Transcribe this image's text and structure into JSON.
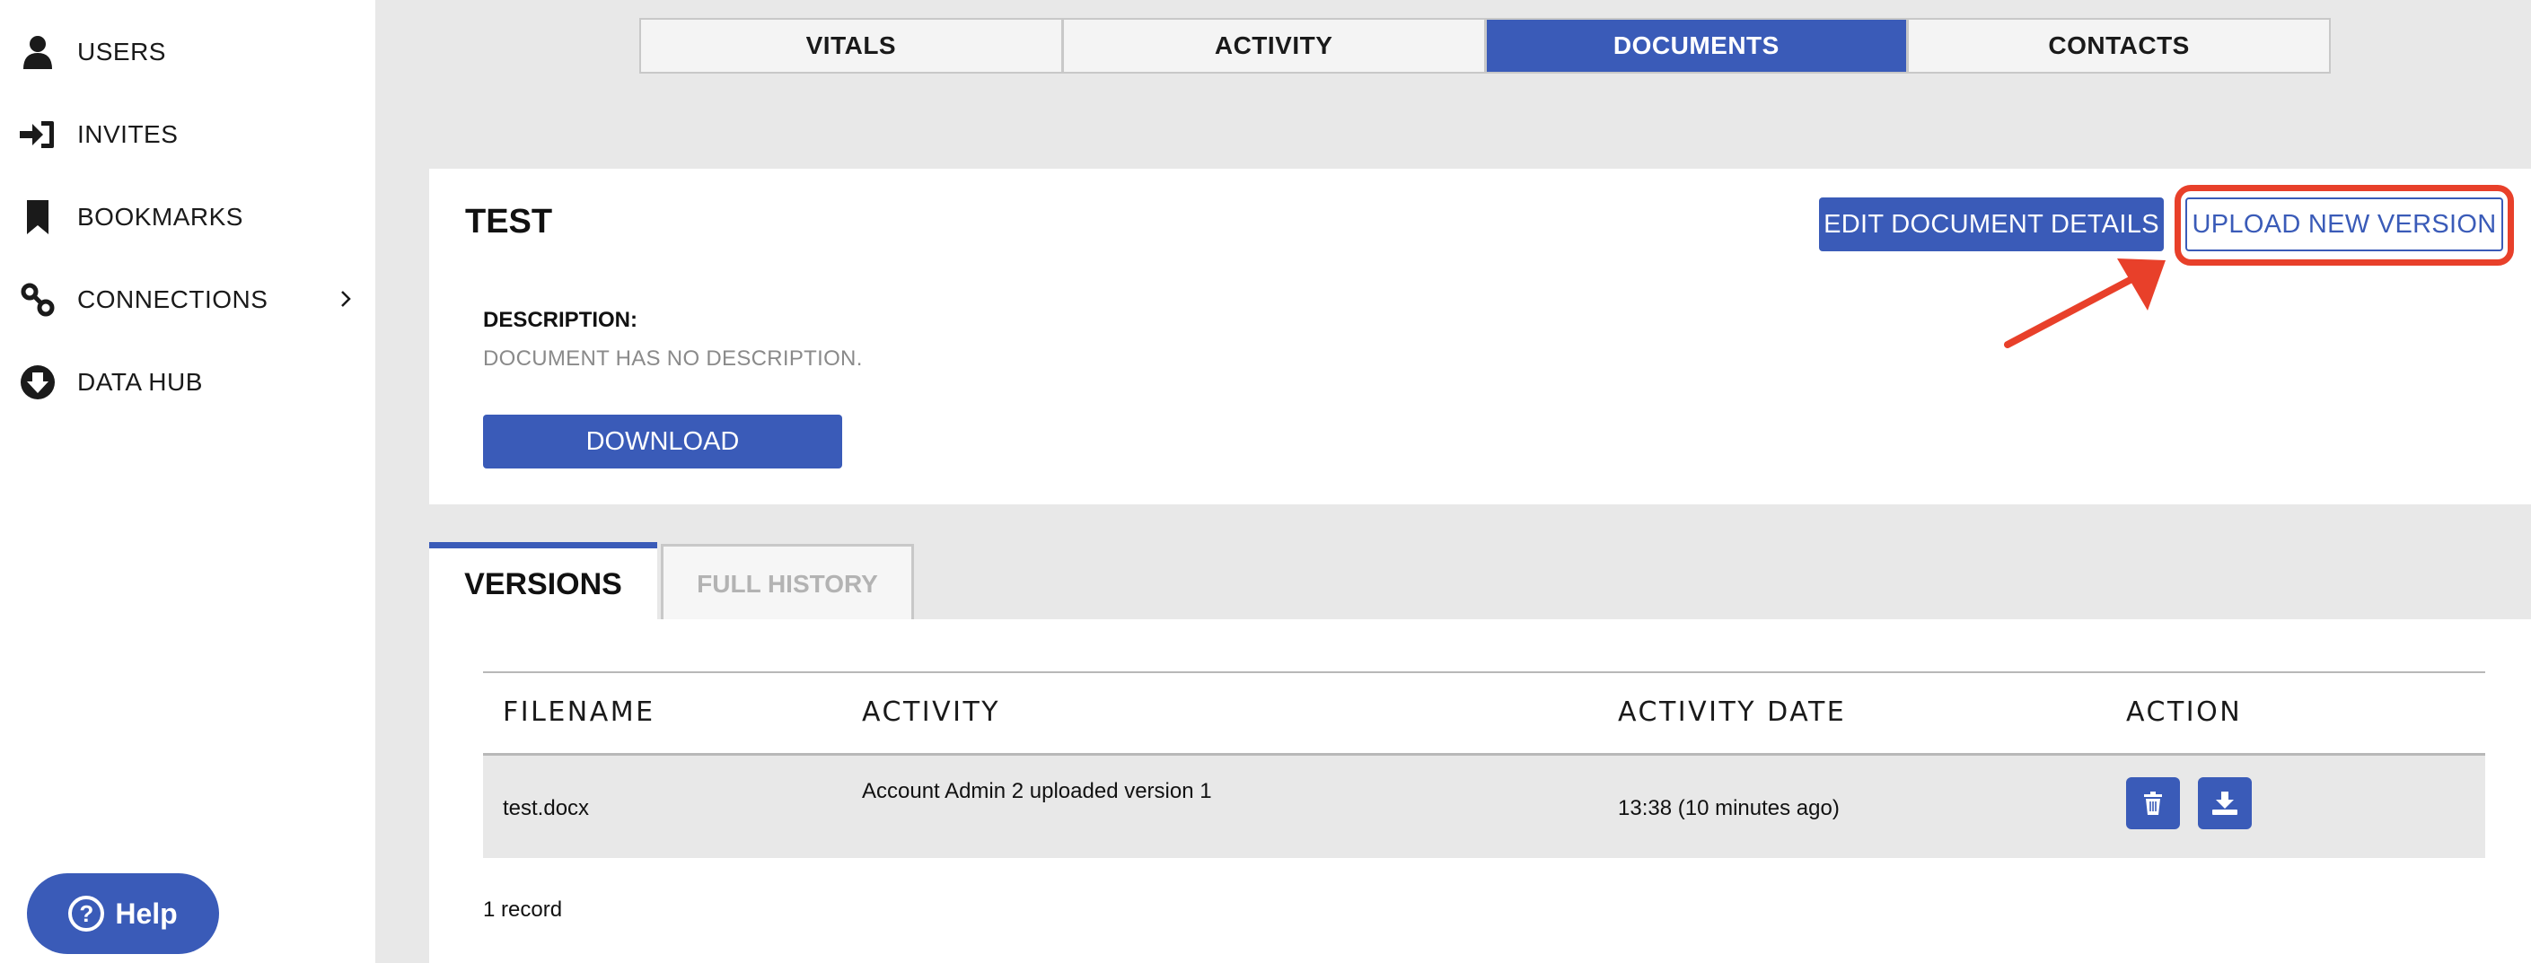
{
  "sidebar": {
    "items": [
      {
        "label": "USERS",
        "icon": "user-icon"
      },
      {
        "label": "INVITES",
        "icon": "sign-in-icon"
      },
      {
        "label": "BOOKMARKS",
        "icon": "bookmark-icon"
      },
      {
        "label": "CONNECTIONS",
        "icon": "link-icon"
      },
      {
        "label": "DATA HUB",
        "icon": "arrow-down-circle-icon"
      }
    ],
    "help_label": "Help"
  },
  "top_tabs": [
    "VITALS",
    "ACTIVITY",
    "DOCUMENTS",
    "CONTACTS"
  ],
  "active_tab": "DOCUMENTS",
  "document": {
    "title": "TEST",
    "edit_label": "EDIT DOCUMENT DETAILS",
    "upload_label": "UPLOAD NEW VERSION",
    "description_label": "DESCRIPTION:",
    "description_text": "DOCUMENT HAS NO DESCRIPTION.",
    "download_label": "DOWNLOAD"
  },
  "version_tabs": {
    "versions": "VERSIONS",
    "history": "FULL HISTORY"
  },
  "table": {
    "headers": [
      "FILENAME",
      "ACTIVITY",
      "ACTIVITY DATE",
      "ACTION"
    ],
    "rows": [
      {
        "filename": "test.docx",
        "activity": "Account Admin 2 uploaded version 1",
        "date": "13:38 (10 minutes ago)"
      }
    ],
    "record_count": "1 record"
  },
  "colors": {
    "accent": "#3a5bb8",
    "highlight": "#e8402a"
  }
}
